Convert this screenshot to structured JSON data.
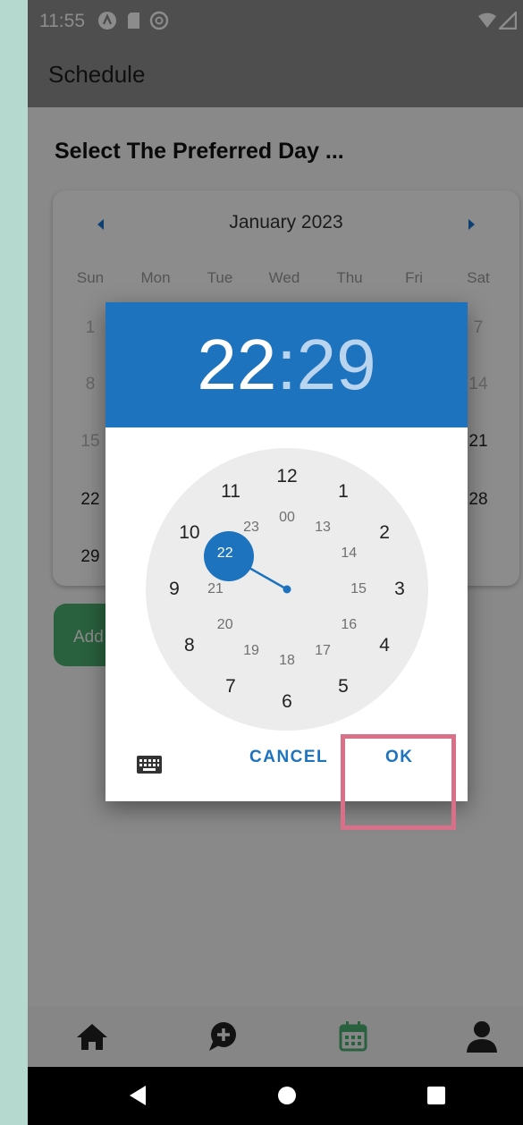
{
  "status_bar": {
    "time": "11:55"
  },
  "app_bar": {
    "title": "Schedule"
  },
  "heading": "Select The Preferred Day ...",
  "calendar": {
    "month": "January 2023",
    "weekdays": [
      "Sun",
      "Mon",
      "Tue",
      "Wed",
      "Thu",
      "Fri",
      "Sat"
    ],
    "visible_days": {
      "col_sun": [
        "1",
        "8",
        "15",
        "22",
        "29"
      ],
      "col_sat": [
        "7",
        "14",
        "21",
        "28"
      ]
    }
  },
  "add_button": {
    "label": "Add"
  },
  "time_picker": {
    "hours": "22",
    "separator": ":",
    "minutes": "29",
    "outer_numbers": [
      "12",
      "1",
      "2",
      "3",
      "4",
      "5",
      "6",
      "7",
      "8",
      "9",
      "10",
      "11"
    ],
    "inner_numbers": [
      "00",
      "13",
      "14",
      "15",
      "16",
      "17",
      "18",
      "19",
      "20",
      "21",
      "22",
      "23"
    ],
    "selected_hour": "22",
    "cancel_label": "CANCEL",
    "ok_label": "OK"
  },
  "colors": {
    "accent": "#1e73bf",
    "highlight": "#d9708a",
    "nav_active": "#4caf70"
  },
  "icons": {
    "status": [
      "a-icon",
      "sd-card-icon",
      "at-icon",
      "wifi-icon",
      "signal-icon"
    ],
    "bottom_nav": [
      "home-icon",
      "chat-icon",
      "calendar-icon",
      "person-icon"
    ],
    "system_nav": [
      "back-icon",
      "home-circle-icon",
      "recents-icon"
    ]
  }
}
